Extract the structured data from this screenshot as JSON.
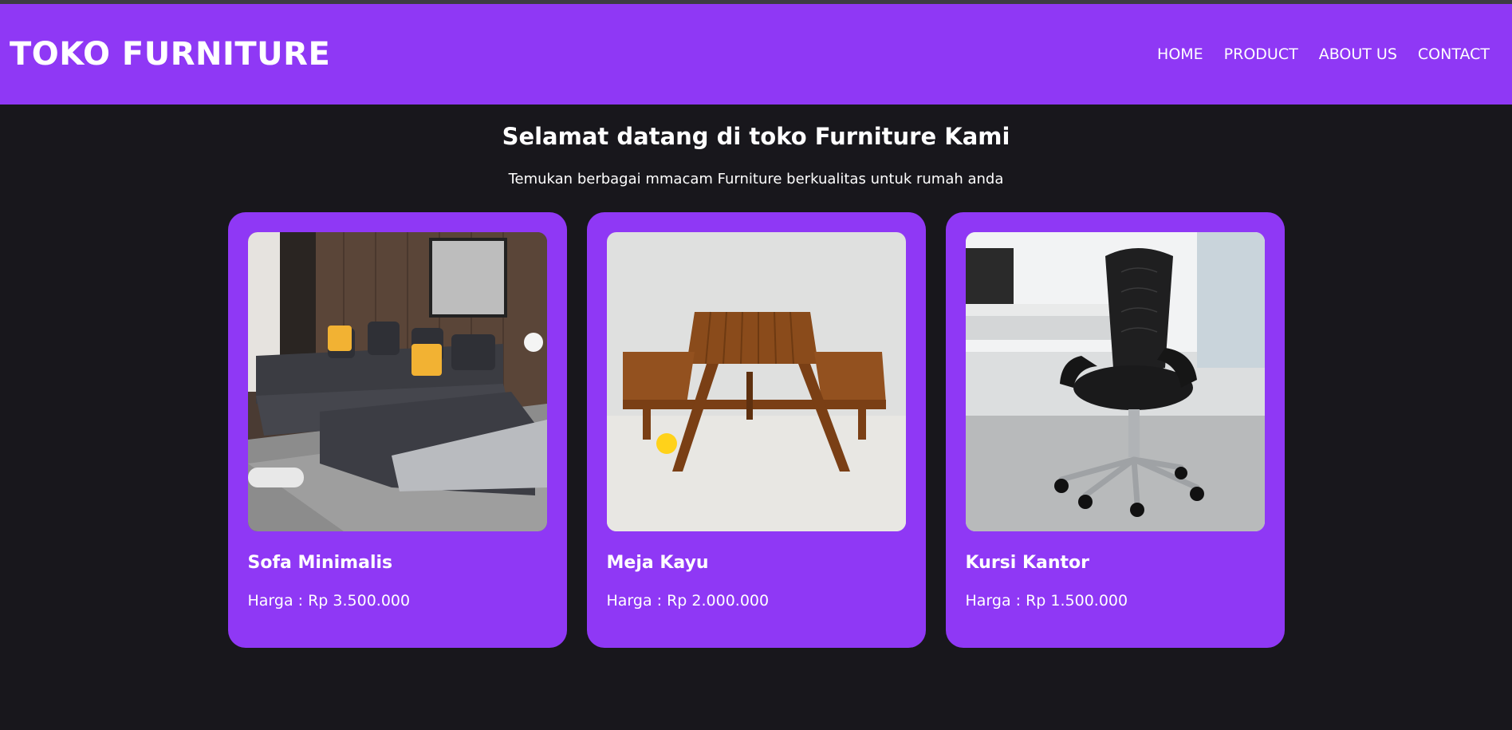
{
  "header": {
    "brand": "TOKO FURNITURE",
    "nav": [
      "HOME",
      "PRODUCT",
      "ABOUT US",
      "CONTACT"
    ]
  },
  "hero": {
    "title": "Selamat datang di toko Furniture Kami",
    "subtitle": "Temukan berbagai mmacam Furniture berkualitas untuk rumah anda"
  },
  "products": [
    {
      "name": "Sofa Minimalis",
      "price": "Harga : Rp 3.500.000",
      "image": "sofa-photo"
    },
    {
      "name": "Meja Kayu",
      "price": "Harga : Rp 2.000.000",
      "image": "wooden-table-photo"
    },
    {
      "name": "Kursi Kantor",
      "price": "Harga : Rp 1.500.000",
      "image": "office-chair-photo"
    }
  ],
  "colors": {
    "accent": "#8f38f5",
    "background": "#18171c"
  }
}
